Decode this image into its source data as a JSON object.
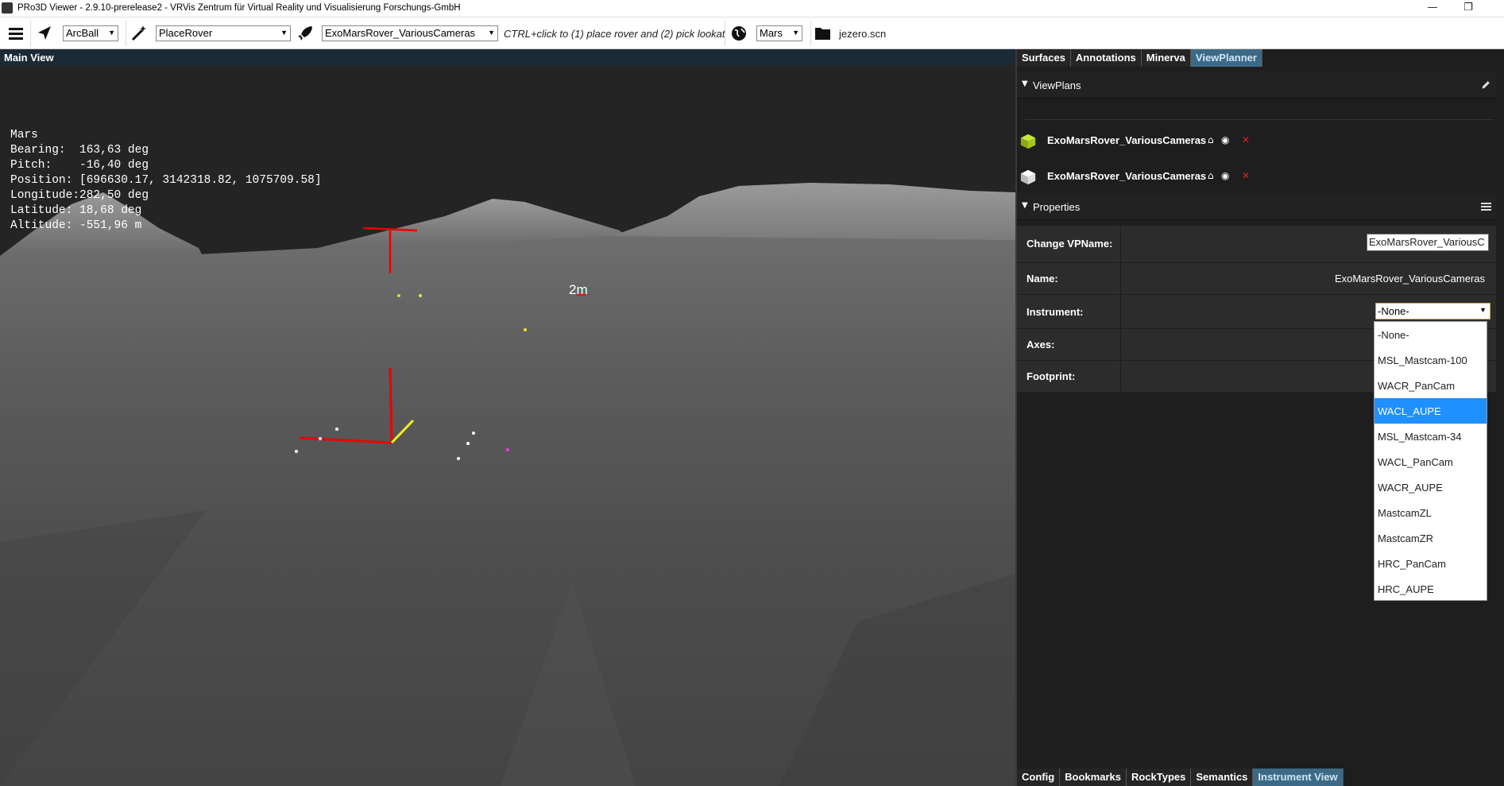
{
  "window": {
    "title": "PRo3D Viewer - 2.9.10-prerelease2 - VRVis Zentrum für Virtual Reality und Visualisierung Forschungs-GmbH",
    "minimize": "—",
    "restore": "❐",
    "close": "✕"
  },
  "toolbar": {
    "navigation_mode": "ArcBall",
    "interaction_mode": "PlaceRover",
    "rover": "ExoMarsRover_VariousCameras",
    "hint": "CTRL+click to (1) place rover and (2) pick lookat",
    "planet": "Mars",
    "scene_file": "jezero.scn"
  },
  "main_view": {
    "title": "Main View",
    "info_lines": [
      "Mars",
      "Bearing:  163,63 deg",
      "Pitch:    -16,40 deg",
      "Position: [696630.17, 3142318.82, 1075709.58]",
      "Longitude:282,50 deg",
      "Latitude: 18,68 deg",
      "Altitude: -551,96 m"
    ],
    "scale_label": "2m"
  },
  "tabs_top": [
    "Surfaces",
    "Annotations",
    "Minerva",
    "ViewPlanner"
  ],
  "tabs_top_active": "ViewPlanner",
  "viewplans": {
    "title": "ViewPlans",
    "items": [
      {
        "name": "ExoMarsRover_VariousCameras",
        "color": "#a6c81e"
      },
      {
        "name": "ExoMarsRover_VariousCameras",
        "color": "#ffffff"
      }
    ]
  },
  "properties": {
    "title": "Properties",
    "change_vpname_label": "Change VPName:",
    "change_vpname_value": "ExoMarsRover_VariousC",
    "name_label": "Name:",
    "name_value": "ExoMarsRover_VariousCameras",
    "instrument_label": "Instrument:",
    "instrument_value": "-None-",
    "axes_label": "Axes:",
    "footprint_label": "Footprint:"
  },
  "instrument_options": [
    "-None-",
    "MSL_Mastcam-100",
    "WACR_PanCam",
    "WACL_AUPE",
    "MSL_Mastcam-34",
    "WACL_PanCam",
    "WACR_AUPE",
    "MastcamZL",
    "MastcamZR",
    "HRC_PanCam",
    "HRC_AUPE"
  ],
  "instrument_highlighted": "WACL_AUPE",
  "tabs_bottom": [
    "Config",
    "Bookmarks",
    "RockTypes",
    "Semantics",
    "Instrument View"
  ],
  "tabs_bottom_active": "Instrument View",
  "colors": {
    "accent_tab": "#3c6a86",
    "highlight": "#1e90ff",
    "delete": "#e02020"
  }
}
